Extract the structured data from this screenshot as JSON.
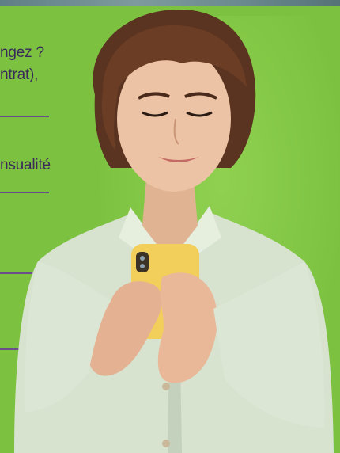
{
  "text_fragments": {
    "line1": "ngez ?",
    "line2": "ntrat),",
    "line3": "nsualité"
  },
  "colors": {
    "background": "#7cc240",
    "text": "#3a2a5a",
    "rule": "#6a4f8a",
    "shirt": "#d9e4d2",
    "phone": "#f2cf5b",
    "hair": "#5a3420"
  },
  "subject": {
    "icon": "woman-holding-phone-photo"
  }
}
